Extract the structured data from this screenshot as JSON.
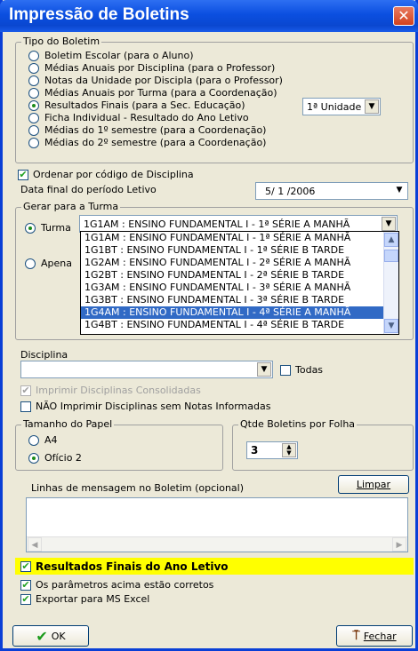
{
  "window": {
    "title": "Impressão de Boletins",
    "close_label": "✕"
  },
  "tipo_boletim": {
    "legend": "Tipo do Boletim",
    "options": [
      {
        "label": "Boletim Escolar (para o Aluno)",
        "selected": false
      },
      {
        "label": "Médias Anuais por Disciplina (para o Professor)",
        "selected": false
      },
      {
        "label": "Notas da Unidade por Discipla (para o Professor)",
        "selected": false
      },
      {
        "label": "Médias Anuais por Turma (para a Coordenação)",
        "selected": false
      },
      {
        "label": "Resultados Finais (para a Sec. Educação)",
        "selected": true
      },
      {
        "label": "Ficha Individual - Resultado do Ano Letivo",
        "selected": false
      },
      {
        "label": "Médias do 1º semestre (para a Coordenação)",
        "selected": false
      },
      {
        "label": "Médias do 2º semestre (para a Coordenação)",
        "selected": false
      }
    ],
    "unidade_value": "1ª Unidade"
  },
  "ordenar": {
    "label": "Ordenar por código de Disciplina",
    "checked": true
  },
  "data_final": {
    "label": "Data final do período Letivo",
    "value": "5/ 1 /2006"
  },
  "gerar": {
    "legend": "Gerar para a Turma",
    "turma_label": "Turma",
    "apenas_label": "Apena",
    "turma_value": "1G1AM : ENSINO FUNDAMENTAL I - 1ª SÉRIE A MANHÃ",
    "list": [
      "1G1AM : ENSINO FUNDAMENTAL I - 1ª SÉRIE A MANHÃ",
      "1G1BT : ENSINO FUNDAMENTAL I - 1ª SÉRIE B TARDE",
      "1G2AM : ENSINO FUNDAMENTAL I - 2ª SÉRIE A MANHÃ",
      "1G2BT : ENSINO FUNDAMENTAL I - 2ª SÉRIE B TARDE",
      "1G3AM : ENSINO FUNDAMENTAL I - 3ª SÉRIE A MANHÃ",
      "1G3BT : ENSINO FUNDAMENTAL I - 3ª SÉRIE B TARDE",
      "1G4AM : ENSINO FUNDAMENTAL I - 4ª SÉRIE A MANHÃ",
      "1G4BT : ENSINO FUNDAMENTAL I - 4ª SÉRIE B TARDE"
    ],
    "selected_index": 6
  },
  "disciplina": {
    "label": "Disciplina",
    "value": "",
    "todas_label": "Todas"
  },
  "imprimir_consolidadas": {
    "label": "Imprimir Disciplinas Consolidadas",
    "checked": true,
    "disabled": true
  },
  "nao_imprimir": {
    "label": "NÃO Imprimir Disciplinas sem Notas Informadas",
    "checked": false
  },
  "papel": {
    "legend": "Tamanho do Papel",
    "options": [
      {
        "label": "A4",
        "selected": false
      },
      {
        "label": "Ofício 2",
        "selected": true
      }
    ]
  },
  "qtde": {
    "legend": "Qtde Boletins por Folha",
    "value": "3"
  },
  "mensagem": {
    "label": "Linhas de mensagem no Boletim (opcional)",
    "limpar_label": "Limpar"
  },
  "final": {
    "resultados_label": "Resultados Finais do Ano Letivo",
    "parametros_label": "Os parâmetros acima estão corretos",
    "exportar_label": "Exportar para MS Excel"
  },
  "buttons": {
    "ok_label": "OK",
    "fechar_label": "Fechar"
  },
  "icons": {
    "check": "✔",
    "arrow_down": "▼",
    "arrow_up": "▲",
    "arrow_left": "◀",
    "arrow_right": "▶"
  }
}
